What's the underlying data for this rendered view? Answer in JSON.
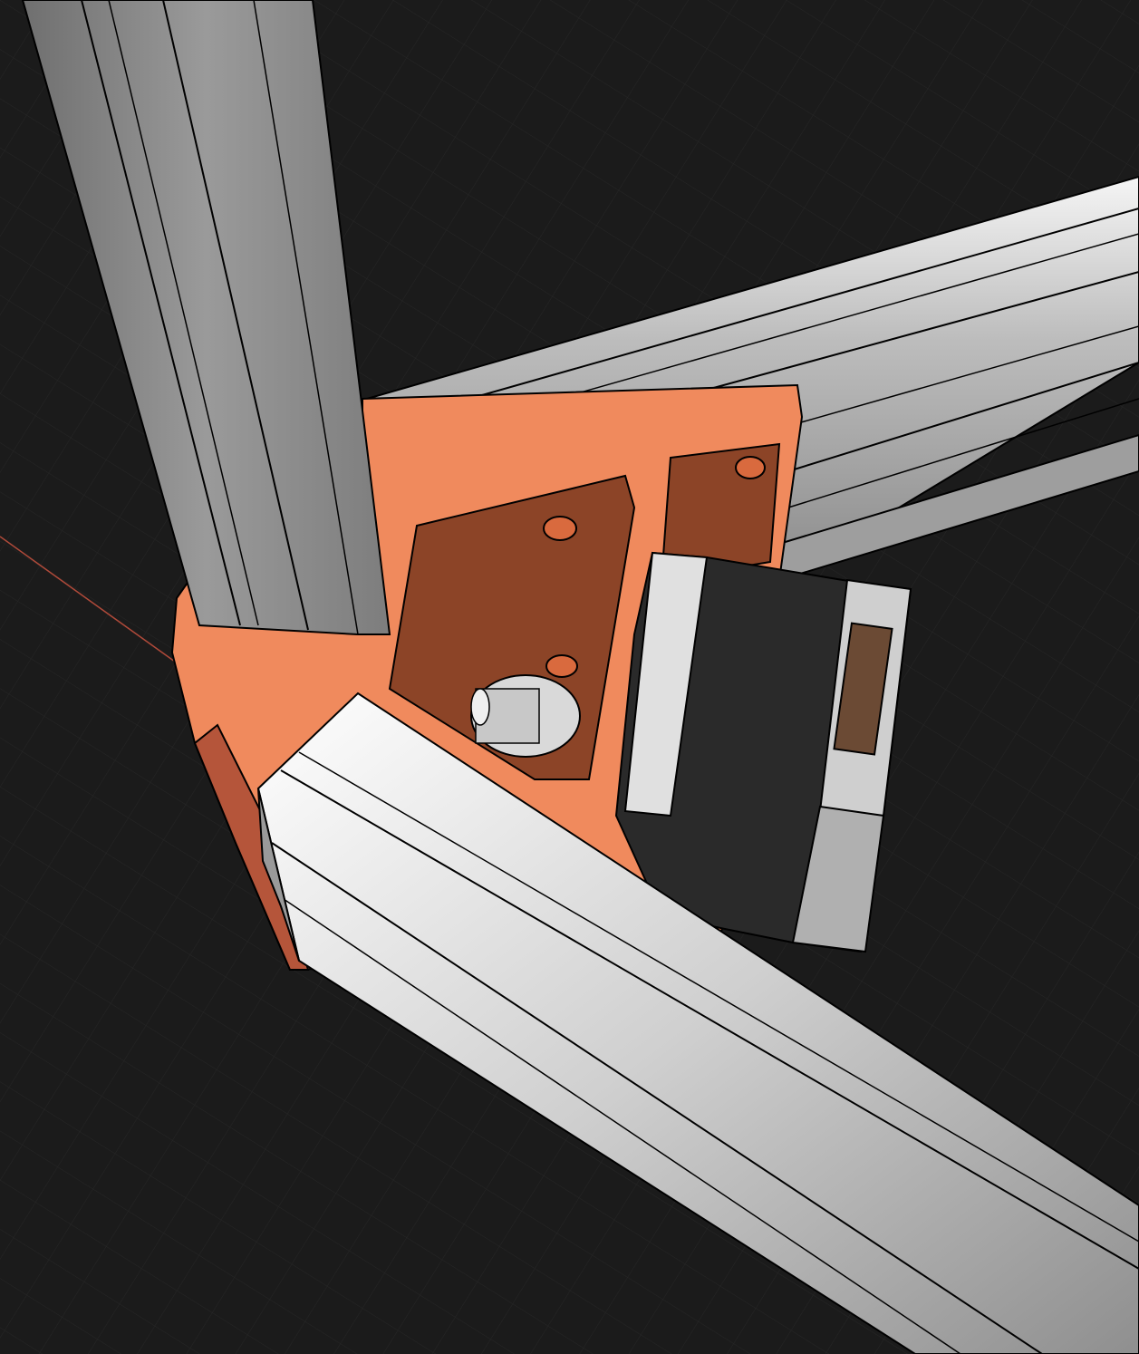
{
  "viewport": {
    "background_color": "#1b1b1b",
    "grid_color": "#262626",
    "axis_color": "#b04a3a"
  },
  "scene": {
    "parts": [
      {
        "name": "vertical-extrusion",
        "color": "#8a8a8a"
      },
      {
        "name": "right-extrusion",
        "color": "#bdbdbd"
      },
      {
        "name": "front-extrusion",
        "color": "#c4c4c4"
      },
      {
        "name": "corner-bracket",
        "color": "#f08a5d"
      },
      {
        "name": "stepper-motor",
        "color": "#2a2a2a"
      },
      {
        "name": "gt2-pulley",
        "color": "#d9d9d9"
      },
      {
        "name": "motor-connector",
        "color": "#6b4a34"
      }
    ],
    "icons": [
      "corner-bracket-icon",
      "stepper-motor-icon",
      "pulley-icon"
    ]
  }
}
